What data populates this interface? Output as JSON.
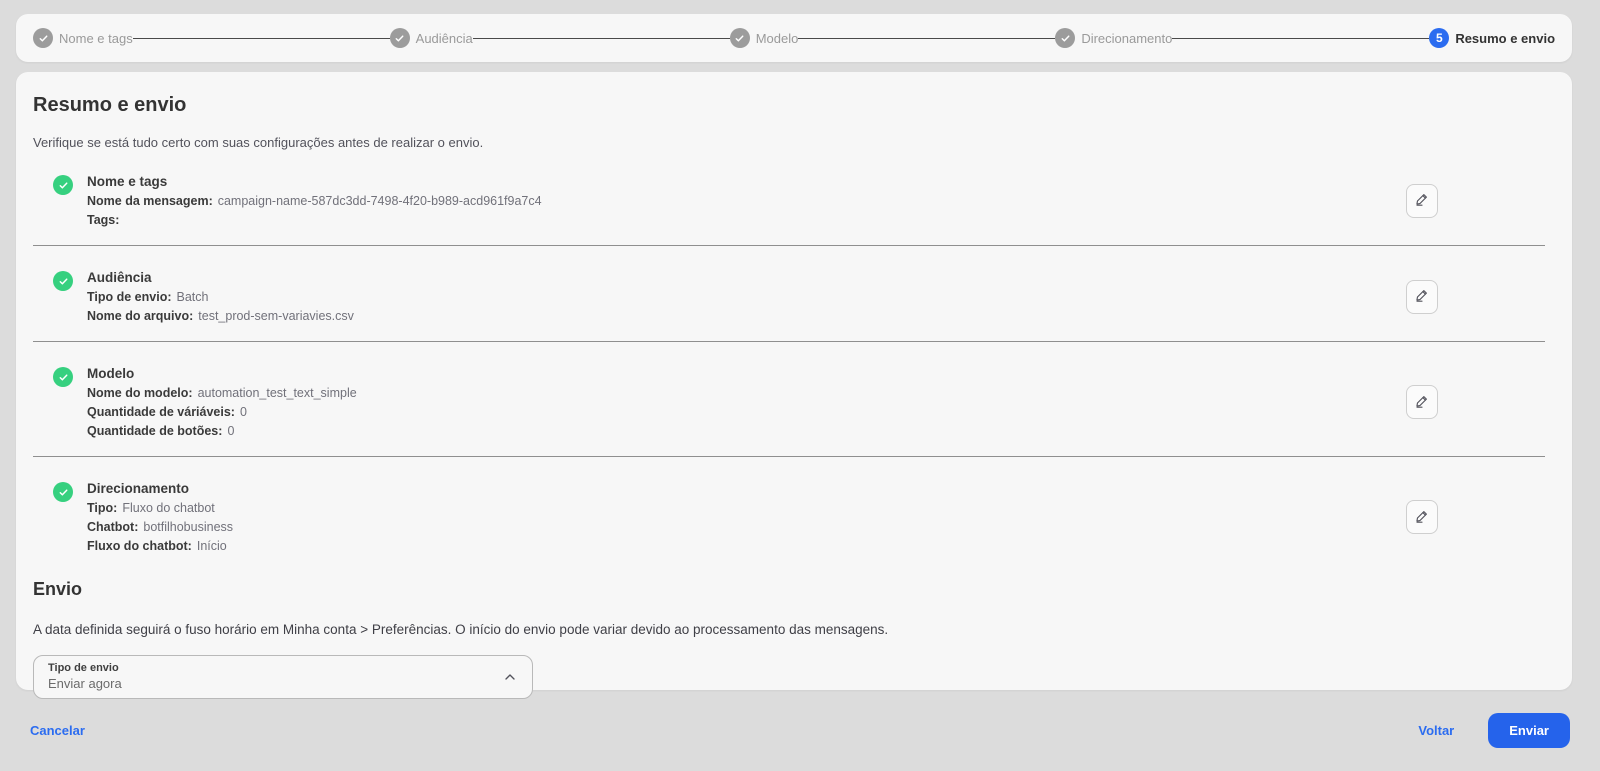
{
  "stepper": {
    "steps": [
      {
        "label": "Nome e tags",
        "state": "completed"
      },
      {
        "label": "Audiência",
        "state": "completed"
      },
      {
        "label": "Modelo",
        "state": "completed"
      },
      {
        "label": "Direcionamento",
        "state": "completed"
      },
      {
        "label": "Resumo e envio",
        "state": "active",
        "number": "5"
      }
    ]
  },
  "summary": {
    "title": "Resumo e envio",
    "subtitle": "Verifique se está tudo certo com suas configurações antes de realizar o envio.",
    "sections": [
      {
        "title": "Nome e tags",
        "fields": [
          {
            "label": "Nome da mensagem:",
            "value": "campaign-name-587dc3dd-7498-4f20-b989-acd961f9a7c4"
          },
          {
            "label": "Tags:",
            "value": ""
          }
        ]
      },
      {
        "title": "Audiência",
        "fields": [
          {
            "label": "Tipo de envio:",
            "value": "Batch"
          },
          {
            "label": "Nome do arquivo:",
            "value": "test_prod-sem-variavies.csv"
          }
        ]
      },
      {
        "title": "Modelo",
        "fields": [
          {
            "label": "Nome do modelo:",
            "value": "automation_test_text_simple"
          },
          {
            "label": "Quantidade de váriáveis:",
            "value": "0"
          },
          {
            "label": "Quantidade de botões:",
            "value": "0"
          }
        ]
      },
      {
        "title": "Direcionamento",
        "fields": [
          {
            "label": "Tipo:",
            "value": "Fluxo do chatbot"
          },
          {
            "label": "Chatbot:",
            "value": "botfilhobusiness"
          },
          {
            "label": "Fluxo do chatbot:",
            "value": "Início"
          }
        ]
      }
    ]
  },
  "envio": {
    "title": "Envio",
    "note": "A data definida seguirá o fuso horário em Minha conta > Preferências. O início do envio pode variar devido ao processamento das mensagens.",
    "select": {
      "label": "Tipo de envio",
      "value": "Enviar agora"
    }
  },
  "footer": {
    "cancel_label": "Cancelar",
    "back_label": "Voltar",
    "submit_label": "Enviar"
  },
  "icons": {
    "completed_step": "check-icon",
    "edit": "pencil-icon",
    "select": "chevron-up-icon"
  },
  "colors": {
    "accent_blue": "#2b6cf0",
    "button_blue": "#2563eb",
    "success_green": "#36d07f",
    "step_gray": "#9c9c9c",
    "page_background": "#dcdcdc",
    "card_background": "#f7f7f7"
  }
}
